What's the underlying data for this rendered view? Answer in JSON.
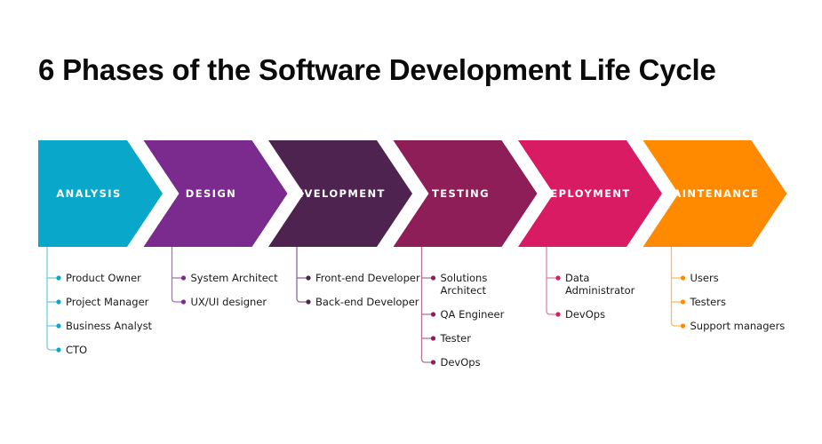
{
  "title": "6 Phases of the Software Development Life Cycle",
  "phases": [
    {
      "label": "ANALYSIS",
      "color": "#09a8cb",
      "line_color": "#6fcfe3",
      "dot_color": "#09a8cb",
      "roles": [
        [
          "Product Owner"
        ],
        [
          "Project Manager"
        ],
        [
          "Business Analyst"
        ],
        [
          "CTO"
        ]
      ]
    },
    {
      "label": "DESIGN",
      "color": "#7b2a8e",
      "line_color": "#a874b5",
      "dot_color": "#7b2a8e",
      "roles": [
        [
          "System Architect"
        ],
        [
          "UX/UI designer"
        ]
      ]
    },
    {
      "label": "DEVELOPMENT",
      "color": "#4f2350",
      "line_color": "#8c6a8c",
      "dot_color": "#4f2350",
      "roles": [
        [
          "Front-end Developer"
        ],
        [
          "Back-end Developer"
        ]
      ]
    },
    {
      "label": "TESTING",
      "color": "#8e1e58",
      "line_color": "#bb6f96",
      "dot_color": "#8e1e58",
      "roles": [
        [
          "Solutions",
          "Architect"
        ],
        [
          "QA Engineer"
        ],
        [
          "Tester"
        ],
        [
          "DevOps"
        ]
      ]
    },
    {
      "label": "DEPLOYMENT",
      "color": "#d81b63",
      "line_color": "#ec7ea6",
      "dot_color": "#d81b63",
      "roles": [
        [
          "Data",
          "Administrator"
        ],
        [
          "DevOps"
        ]
      ]
    },
    {
      "label": "MAINTENANCE",
      "color": "#ff8a00",
      "line_color": "#ffb866",
      "dot_color": "#ff8a00",
      "roles": [
        [
          "Users"
        ],
        [
          "Testers"
        ],
        [
          "Support managers"
        ]
      ]
    }
  ]
}
